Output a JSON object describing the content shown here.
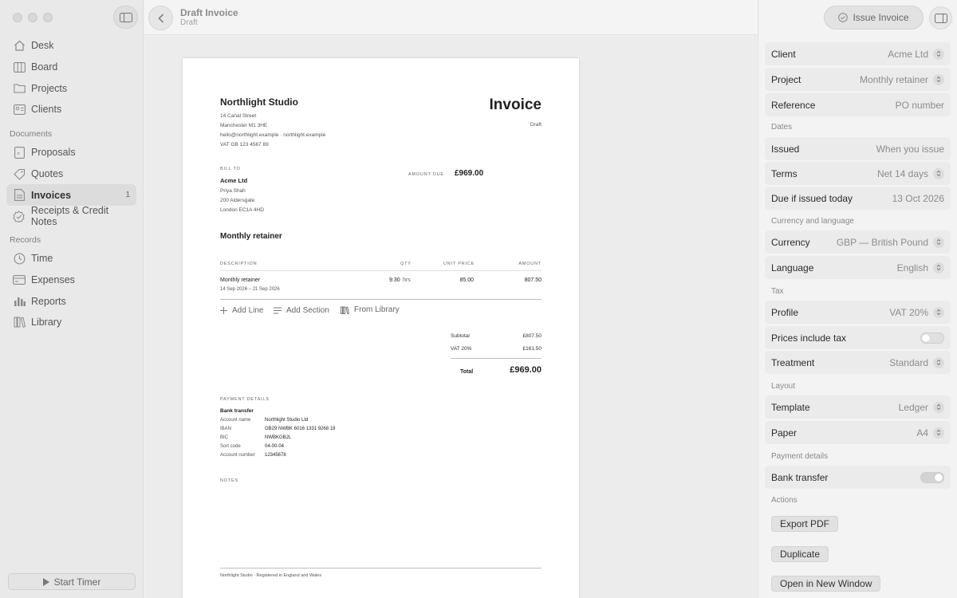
{
  "sidebar": {
    "main_items": [
      {
        "label": "Desk",
        "icon": "home-icon"
      },
      {
        "label": "Board",
        "icon": "board-icon"
      },
      {
        "label": "Projects",
        "icon": "folder-icon"
      },
      {
        "label": "Clients",
        "icon": "clients-icon"
      }
    ],
    "documents_title": "Documents",
    "documents_items": [
      {
        "label": "Proposals",
        "icon": "proposal-icon"
      },
      {
        "label": "Quotes",
        "icon": "tag-icon"
      },
      {
        "label": "Invoices",
        "icon": "invoice-icon",
        "count": "1",
        "active": true
      },
      {
        "label": "Receipts & Credit Notes",
        "icon": "receipt-icon"
      }
    ],
    "records_title": "Records",
    "records_items": [
      {
        "label": "Time",
        "icon": "clock-icon"
      },
      {
        "label": "Expenses",
        "icon": "expenses-icon"
      },
      {
        "label": "Reports",
        "icon": "chart-icon"
      },
      {
        "label": "Library",
        "icon": "library-icon"
      }
    ],
    "start_timer": "Start Timer"
  },
  "topbar": {
    "title": "Draft Invoice",
    "subtitle": "Draft"
  },
  "invoice": {
    "studio_name": "Northlight Studio",
    "address1": "14 Canal Street",
    "address2": "Manchester M1 3HE",
    "contact": "hello@northlight.example · northlight.example",
    "vat": "VAT GB 123 4567 89",
    "heading": "Invoice",
    "status": "Draft",
    "bill_to_label": "BILL TO",
    "client_name": "Acme Ltd",
    "client_contact": "Priya Shah",
    "client_addr1": "200 Aldersgate",
    "client_addr2": "London EC1A 4HD",
    "amount_due_label": "AMOUNT DUE",
    "amount_due": "£969.00",
    "project_title": "Monthly retainer",
    "col_description": "DESCRIPTION",
    "col_qty": "QTY",
    "col_unit_price": "UNIT PRICE",
    "col_amount": "AMOUNT",
    "line": {
      "description": "Monthly retainer",
      "period": "14 Sep 2026 – 21 Sep 2026",
      "qty": "9:30",
      "unit": "hrs",
      "unit_price": "85.00",
      "amount": "807.50"
    },
    "add_line": "Add Line",
    "add_section": "Add Section",
    "from_library": "From Library",
    "subtotal_label": "Subtotal",
    "subtotal": "£807.50",
    "vat_label": "VAT 20%",
    "vat_amount": "£161.50",
    "total_label": "Total",
    "total": "£969.00",
    "payment_label": "PAYMENT DETAILS",
    "payment_method": "Bank transfer",
    "payment_rows": [
      {
        "k": "Account name",
        "v": "Northlight Studio Ltd"
      },
      {
        "k": "IBAN",
        "v": "GB29 NWBK 6016 1331 9268 19"
      },
      {
        "k": "BIC",
        "v": "NWBKGB2L"
      },
      {
        "k": "Sort code",
        "v": "04-00-04"
      },
      {
        "k": "Account number",
        "v": "12345678"
      }
    ],
    "notes_label": "NOTES",
    "footer": "Northlight Studio · Registered in England and Wales"
  },
  "inspector": {
    "issue_button": "Issue Invoice",
    "client": {
      "label": "Client",
      "value": "Acme Ltd"
    },
    "project": {
      "label": "Project",
      "value": "Monthly retainer"
    },
    "reference": {
      "label": "Reference",
      "value": "PO number"
    },
    "dates_title": "Dates",
    "issued": {
      "label": "Issued",
      "value": "When you issue"
    },
    "terms": {
      "label": "Terms",
      "value": "Net 14 days"
    },
    "due": {
      "label": "Due if issued today",
      "value": "13 Oct 2026"
    },
    "currency_title": "Currency and language",
    "currency": {
      "label": "Currency",
      "value": "GBP — British Pound"
    },
    "language": {
      "label": "Language",
      "value": "English"
    },
    "tax_title": "Tax",
    "profile": {
      "label": "Profile",
      "value": "VAT 20%"
    },
    "prices_include_tax": {
      "label": "Prices include tax",
      "on": false
    },
    "treatment": {
      "label": "Treatment",
      "value": "Standard"
    },
    "layout_title": "Layout",
    "template": {
      "label": "Template",
      "value": "Ledger"
    },
    "paper": {
      "label": "Paper",
      "value": "A4"
    },
    "payment_title": "Payment details",
    "bank_transfer": {
      "label": "Bank transfer",
      "on": true
    },
    "actions_title": "Actions",
    "export_pdf": "Export PDF",
    "duplicate": "Duplicate",
    "open_new_window": "Open in New Window"
  }
}
